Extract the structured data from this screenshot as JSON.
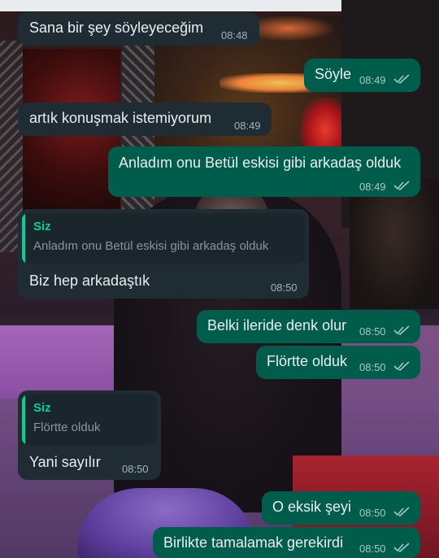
{
  "messages": [
    {
      "direction": "in",
      "text": "Sana bir şey söyleyeceğim",
      "time": "08:48"
    },
    {
      "direction": "out",
      "text": "Söyle",
      "time": "08:49"
    },
    {
      "direction": "in",
      "text": "artık konuşmak istemiyorum",
      "time": "08:49"
    },
    {
      "direction": "out",
      "text": "Anladım onu Betül eskisi gibi arkadaş olduk",
      "time": "08:49"
    },
    {
      "direction": "in",
      "quote_author": "Siz",
      "quote_text": "Anladım onu Betül eskisi gibi arkadaş olduk",
      "text": "Biz hep arkadaştık",
      "time": "08:50"
    },
    {
      "direction": "out",
      "text": "Belki ileride denk olur",
      "time": "08:50"
    },
    {
      "direction": "out",
      "text": "Flörtte olduk",
      "time": "08:50"
    },
    {
      "direction": "in",
      "quote_author": "Siz",
      "quote_text": "Flörtte olduk",
      "text": "Yani sayılır",
      "time": "08:50"
    },
    {
      "direction": "out",
      "text": "O eksik şeyi",
      "time": "08:50"
    },
    {
      "direction": "out",
      "text": "Birlikte tamalamak gerekirdi",
      "time": "08:50"
    }
  ],
  "icons": {
    "read_receipt": "double-check-icon"
  },
  "colors": {
    "incoming_bubble": "#1f2c34",
    "outgoing_bubble": "#005c4b",
    "quote_accent": "#06cf9c",
    "text": "#e9edef"
  }
}
